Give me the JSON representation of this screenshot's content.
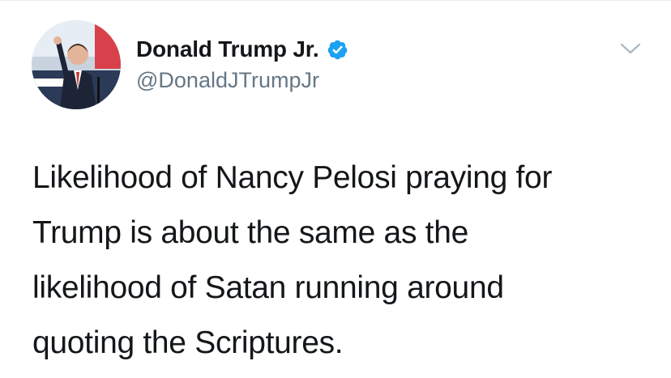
{
  "author": {
    "display_name": "Donald Trump Jr.",
    "handle": "@DonaldJTrumpJr",
    "verified": true,
    "avatar_icon": "profile-photo"
  },
  "tweet": {
    "lines": [
      "Likelihood of Nancy Pelosi praying for",
      "Trump is about the same as the",
      "likelihood of Satan running around",
      "quoting the Scriptures."
    ]
  },
  "icons": {
    "verified_badge": "verified-check-icon",
    "menu": "chevron-down-icon"
  },
  "colors": {
    "text": "#14171a",
    "secondary": "#657786",
    "verified_blue": "#1da1f2",
    "chevron": "#aab8c2"
  }
}
